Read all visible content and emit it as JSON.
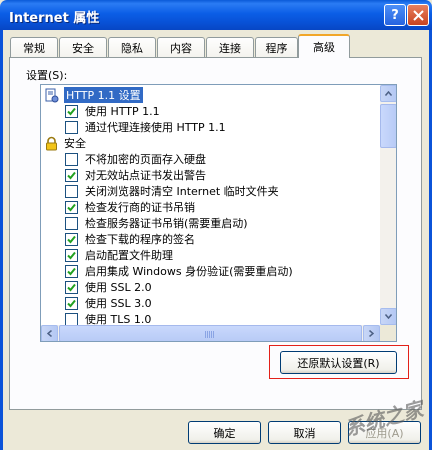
{
  "window": {
    "title": "Internet 属性",
    "help_glyph": "?"
  },
  "tabs": [
    {
      "label": "常规",
      "active": false
    },
    {
      "label": "安全",
      "active": false
    },
    {
      "label": "隐私",
      "active": false
    },
    {
      "label": "内容",
      "active": false
    },
    {
      "label": "连接",
      "active": false
    },
    {
      "label": "程序",
      "active": false
    },
    {
      "label": "高级",
      "active": true
    }
  ],
  "settings": {
    "label": "设置(S):",
    "items": [
      {
        "kind": "category",
        "icon": "document-gear-icon",
        "label": "HTTP 1.1 设置",
        "selected": true
      },
      {
        "kind": "checkbox",
        "label": "使用 HTTP 1.1",
        "checked": true
      },
      {
        "kind": "checkbox",
        "label": "通过代理连接使用 HTTP 1.1",
        "checked": false
      },
      {
        "kind": "category",
        "icon": "lock-icon",
        "label": "安全",
        "selected": false
      },
      {
        "kind": "checkbox",
        "label": "不将加密的页面存入硬盘",
        "checked": false
      },
      {
        "kind": "checkbox",
        "label": "对无效站点证书发出警告",
        "checked": true
      },
      {
        "kind": "checkbox",
        "label": "关闭浏览器时清空 Internet 临时文件夹",
        "checked": false
      },
      {
        "kind": "checkbox",
        "label": "检查发行商的证书吊销",
        "checked": true
      },
      {
        "kind": "checkbox",
        "label": "检查服务器证书吊销(需要重启动)",
        "checked": false
      },
      {
        "kind": "checkbox",
        "label": "检查下载的程序的签名",
        "checked": true
      },
      {
        "kind": "checkbox",
        "label": "启动配置文件助理",
        "checked": true
      },
      {
        "kind": "checkbox",
        "label": "启用集成 Windows 身份验证(需要重启动)",
        "checked": true
      },
      {
        "kind": "checkbox",
        "label": "使用 SSL 2.0",
        "checked": true
      },
      {
        "kind": "checkbox",
        "label": "使用 SSL 3.0",
        "checked": true
      },
      {
        "kind": "checkbox",
        "label": "使用 TLS 1.0",
        "checked": false
      }
    ]
  },
  "buttons": {
    "restore": "还原默认设置(R)",
    "ok": "确定",
    "cancel": "取消",
    "apply": "应用(A)"
  },
  "watermark": "系统之家",
  "colors": {
    "titlebar": "#0b5ee6",
    "selection": "#316ac5",
    "highlight_outline": "#e32119",
    "check": "#21a121"
  }
}
